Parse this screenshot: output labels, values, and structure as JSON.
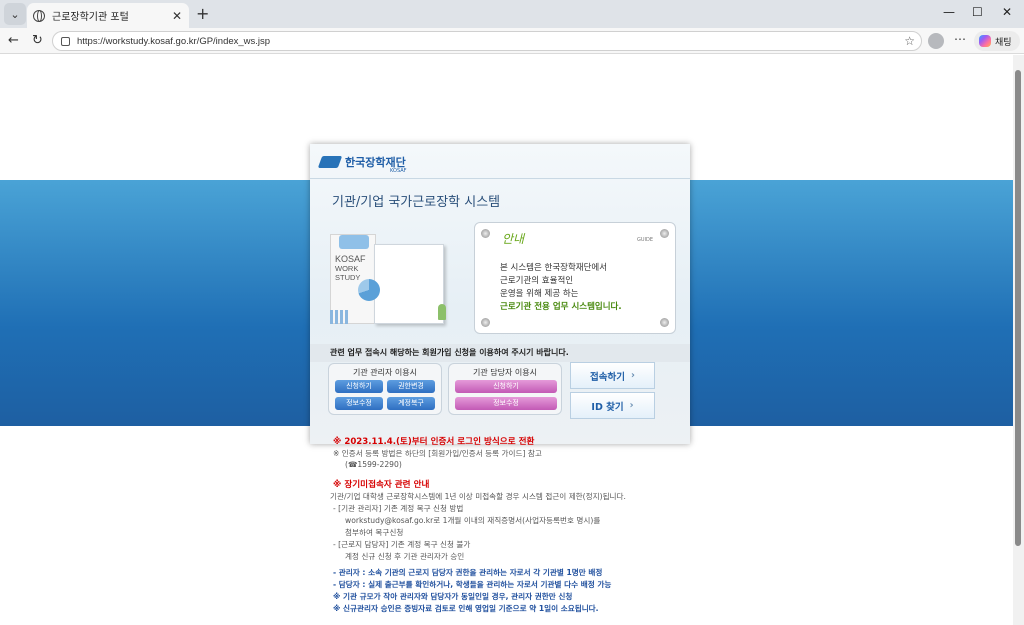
{
  "browser": {
    "tab_title": "근로장학기관 포털",
    "tab_close": "✕",
    "new_tab": "+",
    "url": "https://workstudy.kosaf.go.kr/GP/index_ws.jsp",
    "copilot_label": "채팅",
    "window_controls": [
      "—",
      "☐",
      "✕"
    ]
  },
  "page": {
    "brand_name": "한국장학재단",
    "brand_sub": "KOSAF",
    "system_title": "기관/기업 국가근로장학 시스템",
    "illustration_text": "KOSAF\nWORK\nSTUDY",
    "guide": {
      "heading": "안내",
      "tag": "GUIDE",
      "lines": [
        "본 시스템은 한국장학재단에서",
        "근로기관의 효율적인",
        "운영을 위해 제공 하는",
        "근로기관 전용 업무 시스템입니다."
      ]
    },
    "info_strip": "관련 업무 접속시 해당하는 회원가입 신청을 이용하여 주시기 바랍니다.",
    "admin_group": {
      "title": "기관 관리자 이용시",
      "buttons": [
        "신청하기",
        "권한변경",
        "정보수정",
        "계정복구"
      ]
    },
    "manager_group": {
      "title": "기관 담당자 이용시",
      "buttons": [
        "신청하기",
        "정보수정"
      ]
    },
    "login_button": "접속하기",
    "find_id_button": "ID 찾기",
    "notices": [
      {
        "text": "※ 2023.11.4.(토)부터 인증서 로그인 방식으로 전환",
        "style": "red"
      },
      {
        "text": "※ 인증서 등록 방법은 하단의 [회원가입/인증서 등록 가이드] 참고",
        "style": "normal"
      },
      {
        "text": "(☎1599-2290)",
        "style": "normal"
      },
      {
        "text": "※ 장기미접속자 관련 안내",
        "style": "red"
      },
      {
        "text": "기관/기업 대학생 근로장학시스템에 1년 이상 미접속할 경우 시스템 접근이 제한(정지)됩니다.",
        "style": "normal"
      },
      {
        "text": "- [기관 관리자] 기존 계정 복구 신청 방법",
        "style": "normal"
      },
      {
        "text": "workstudy@kosaf.go.kr로 1개월 이내의 재직증명서(사업자등록번호 명시)를",
        "style": "normal"
      },
      {
        "text": "첨부하여 복구신청",
        "style": "normal"
      },
      {
        "text": "- [근로지 담당자] 기존 계정 복구 신청 불가",
        "style": "normal"
      },
      {
        "text": "계정 신규 신청 후 기관 관리자가 승인",
        "style": "normal"
      },
      {
        "text": "- 관리자 : 소속 기관의 근로지 담당자 권한을 관리하는 자로서 각 기관별 1명만 배정",
        "style": "blue"
      },
      {
        "text": "- 담당자 : 실제 출근부를 확인하거나, 학생들을 관리하는 자로서 기관별 다수 배정 가능",
        "style": "blue"
      },
      {
        "text": "※ 기관 규모가 작아 관리자와 담당자가 동일인일 경우, 관리자 권한만 신청",
        "style": "blue"
      },
      {
        "text": "※ 신규관리자 승인은 증빙자료 검토로 인해 영업일 기준으로 약 1일이 소요됩니다.",
        "style": "blue"
      }
    ]
  }
}
